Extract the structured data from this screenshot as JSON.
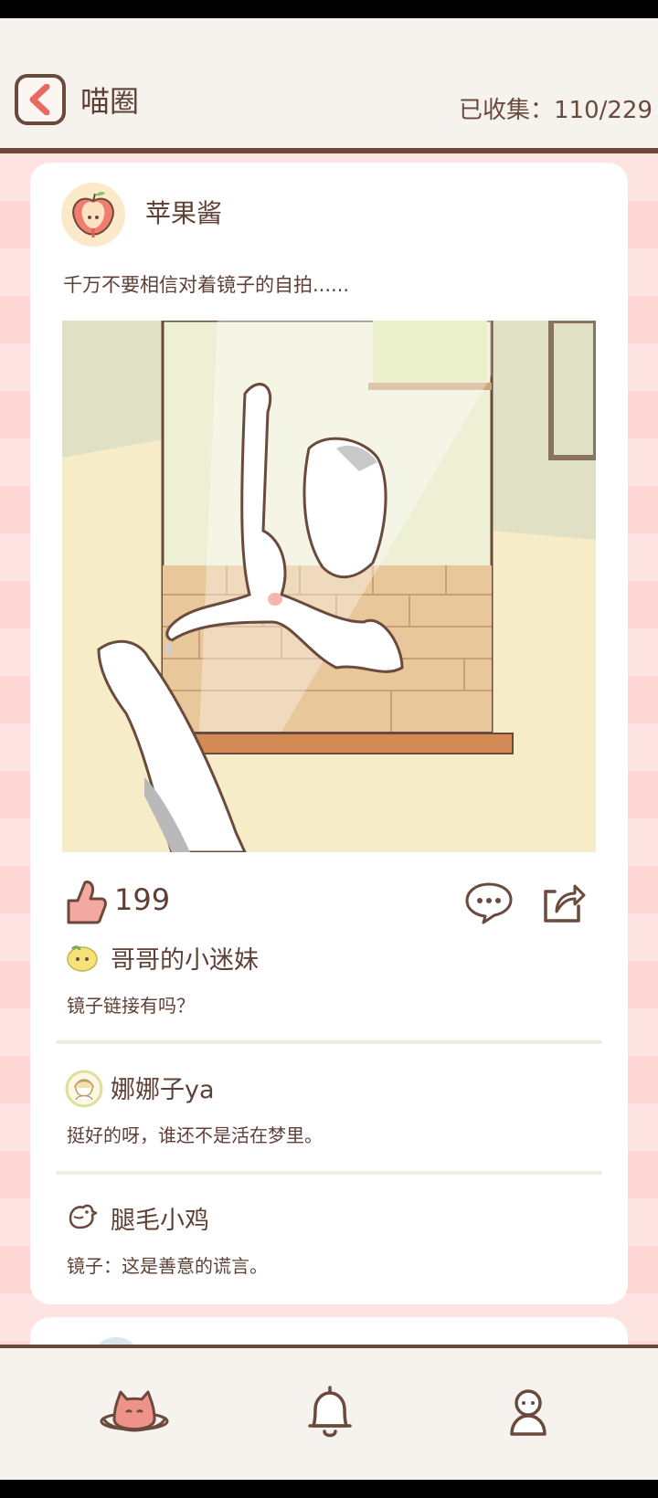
{
  "header": {
    "title": "喵圈",
    "collect_label": "已收集：110/229"
  },
  "post": {
    "author": "苹果酱",
    "text": "千万不要相信对着镜子的自拍......",
    "likes": "199",
    "comments": [
      {
        "user": "哥哥的小迷妹",
        "text": "镜子链接有吗？",
        "avatar_icon": "lemon-icon"
      },
      {
        "user": "娜娜子ya",
        "text": "挺好的呀，谁还不是活在梦里。",
        "avatar_icon": "girl-avatar-icon"
      },
      {
        "user": "腿毛小鸡",
        "text": "镜子：这是善意的谎言。",
        "avatar_icon": "chick-icon"
      }
    ]
  },
  "tabs": [
    {
      "name": "cat-planet-icon",
      "active": true
    },
    {
      "name": "bell-icon",
      "active": false
    },
    {
      "name": "profile-icon",
      "active": false
    }
  ],
  "colors": {
    "accent": "#e86a5f",
    "brown": "#6b4a3e",
    "feed_pink": "#fde3e1"
  }
}
